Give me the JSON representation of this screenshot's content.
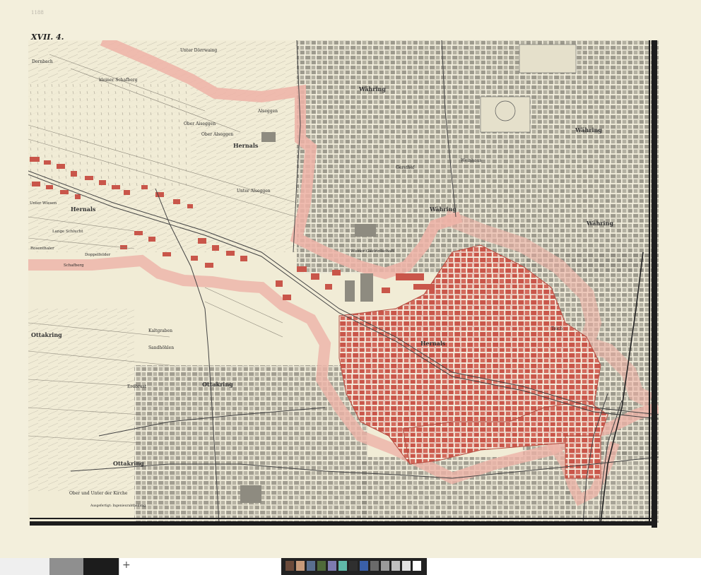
{
  "sheet": {
    "id": "XVII. 4.",
    "corner_note": "1188"
  },
  "colors": {
    "paper": "#f3efdc",
    "built_red": "#c9564a",
    "boundary_pink": "#eeb3a7",
    "ink": "#2a2a2a",
    "street": "#f7f3e3"
  },
  "labels": {
    "unter_doerrwaing": "Unter Dörrwaing",
    "kleiner_schafberg": "kleiner Schafberg",
    "dornbach": "Dornbach",
    "ober_aiseggen": "Ober Aiseggen",
    "aiseggen": "Alseggen",
    "ober_alseggen": "Ober Alseggen",
    "unter_alseggen": "Unter Alseggen",
    "hernals_top": "Hernals",
    "hernals_left": "Hernals",
    "unter_wiesen": "Unter Wiesen",
    "lange_schlucht": "Lange Schlucht",
    "rosenthaler": "Rosenthaler",
    "doppelfeld": "Doppelfelder",
    "schafberg": "Schafberg",
    "kaltgraben": "Kaltgraben",
    "sandhuetten": "Sandhöhlen",
    "ottakring_left": "Ottakring",
    "ottakring_mid": "Ottakring",
    "ottakring_bottom": "Ottakring",
    "erdbrust": "Erdbrust",
    "ober_unter_kirche": "Ober und Unter der Kirche",
    "bottom_note": "Ausgefertigt: Ingenieurabtheilung",
    "waehring_top": "Währing",
    "waehring_right": "Währing",
    "waehring_mid": "Währing",
    "waehring_far": "Währing",
    "weinhaus": "Weinhaus",
    "gersthof": "Gersthof",
    "hernals_center": "Hernals",
    "jubilaeum": "Wiener Gastrintschaft",
    "teiche": "Teich"
  }
}
